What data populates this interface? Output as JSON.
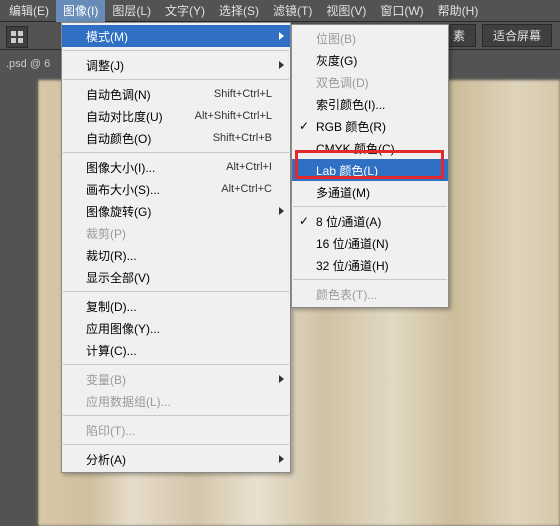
{
  "menubar": {
    "items": [
      {
        "label": "编辑(E)"
      },
      {
        "label": "图像(I)"
      },
      {
        "label": "图层(L)"
      },
      {
        "label": "文字(Y)"
      },
      {
        "label": "选择(S)"
      },
      {
        "label": "滤镜(T)"
      },
      {
        "label": "视图(V)"
      },
      {
        "label": "窗口(W)"
      },
      {
        "label": "帮助(H)"
      }
    ],
    "active_index": 1
  },
  "toolbar": {
    "btn1": "素",
    "btn2": "适合屏幕"
  },
  "doc_tab": ".psd @ 6",
  "main_menu": [
    {
      "type": "item",
      "label": "模式(M)",
      "submenu": true,
      "highlight": true
    },
    {
      "type": "sep"
    },
    {
      "type": "item",
      "label": "调整(J)",
      "submenu": true
    },
    {
      "type": "sep"
    },
    {
      "type": "item",
      "label": "自动色调(N)",
      "shortcut": "Shift+Ctrl+L"
    },
    {
      "type": "item",
      "label": "自动对比度(U)",
      "shortcut": "Alt+Shift+Ctrl+L"
    },
    {
      "type": "item",
      "label": "自动颜色(O)",
      "shortcut": "Shift+Ctrl+B"
    },
    {
      "type": "sep"
    },
    {
      "type": "item",
      "label": "图像大小(I)...",
      "shortcut": "Alt+Ctrl+I"
    },
    {
      "type": "item",
      "label": "画布大小(S)...",
      "shortcut": "Alt+Ctrl+C"
    },
    {
      "type": "item",
      "label": "图像旋转(G)",
      "submenu": true
    },
    {
      "type": "item",
      "label": "裁剪(P)",
      "disabled": true
    },
    {
      "type": "item",
      "label": "裁切(R)...",
      "disabled": false
    },
    {
      "type": "item",
      "label": "显示全部(V)"
    },
    {
      "type": "sep"
    },
    {
      "type": "item",
      "label": "复制(D)..."
    },
    {
      "type": "item",
      "label": "应用图像(Y)..."
    },
    {
      "type": "item",
      "label": "计算(C)..."
    },
    {
      "type": "sep"
    },
    {
      "type": "item",
      "label": "变量(B)",
      "submenu": true,
      "disabled": true
    },
    {
      "type": "item",
      "label": "应用数据组(L)...",
      "disabled": true
    },
    {
      "type": "sep"
    },
    {
      "type": "item",
      "label": "陷印(T)...",
      "disabled": true
    },
    {
      "type": "sep"
    },
    {
      "type": "item",
      "label": "分析(A)",
      "submenu": true
    }
  ],
  "sub_menu": [
    {
      "type": "item",
      "label": "位图(B)",
      "disabled": true
    },
    {
      "type": "item",
      "label": "灰度(G)"
    },
    {
      "type": "item",
      "label": "双色调(D)",
      "disabled": true
    },
    {
      "type": "item",
      "label": "索引颜色(I)..."
    },
    {
      "type": "item",
      "label": "RGB 颜色(R)",
      "checked": true
    },
    {
      "type": "item",
      "label": "CMYK 颜色(C)"
    },
    {
      "type": "item",
      "label": "Lab 颜色(L)",
      "highlight": true
    },
    {
      "type": "item",
      "label": "多通道(M)"
    },
    {
      "type": "sep"
    },
    {
      "type": "item",
      "label": "8 位/通道(A)",
      "checked": true
    },
    {
      "type": "item",
      "label": "16 位/通道(N)"
    },
    {
      "type": "item",
      "label": "32 位/通道(H)"
    },
    {
      "type": "sep"
    },
    {
      "type": "item",
      "label": "颜色表(T)...",
      "disabled": true
    }
  ]
}
